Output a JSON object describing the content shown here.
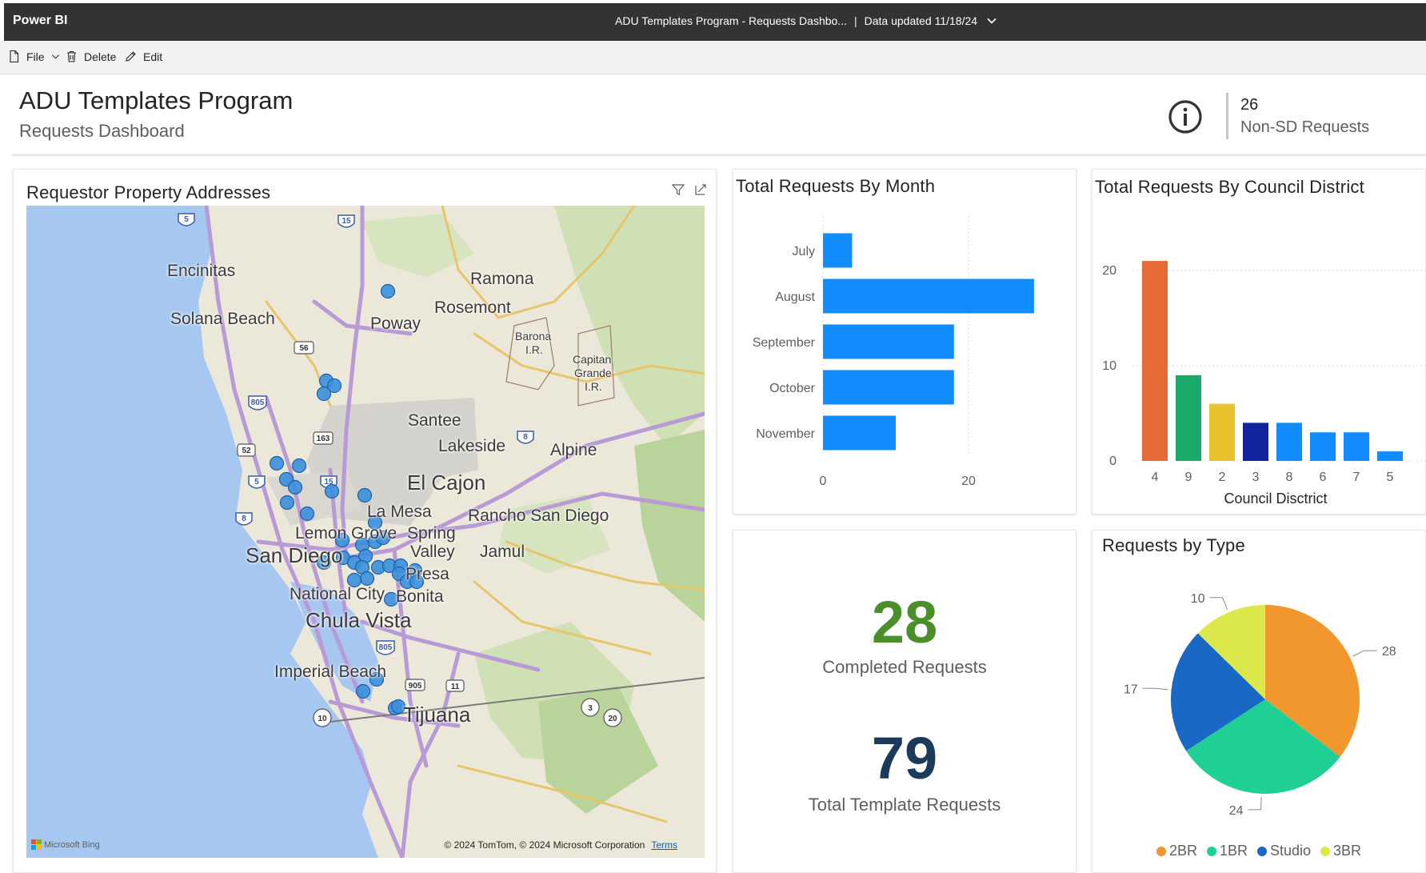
{
  "app": {
    "brand": "Power BI",
    "report_title": "ADU Templates Program - Requests Dashbo...",
    "data_updated": "Data updated 11/18/24"
  },
  "toolbar": {
    "file_label": "File",
    "delete_label": "Delete",
    "edit_label": "Edit"
  },
  "header": {
    "title": "ADU Templates Program",
    "subtitle": "Requests Dashboard",
    "non_sd_value": "26",
    "non_sd_label": "Non-SD Requests"
  },
  "map": {
    "title": "Requestor Property Addresses",
    "cities": [
      "Encinitas",
      "Solana Beach",
      "Ramona",
      "Rosemont",
      "Poway",
      "Santee",
      "Lakeside",
      "Alpine",
      "El Cajon",
      "La Mesa",
      "Rancho San Diego",
      "Lemon Grove",
      "Spring",
      "Valley",
      "Jamul",
      "San Diego",
      "Presa",
      "National City",
      "Bonita",
      "Chula Vista",
      "Imperial Beach",
      "Tijuana",
      "Barona",
      "I.R.",
      "Capitan",
      "Grande",
      "I.R."
    ],
    "highways": [
      "5",
      "15",
      "56",
      "805",
      "52",
      "163",
      "8",
      "15",
      "5",
      "8",
      "805",
      "905",
      "11",
      "10",
      "3",
      "20"
    ],
    "bing_label": "Microsoft Bing",
    "credits": "© 2024 TomTom, © 2024 Microsoft Corporation",
    "terms": "Terms",
    "point_color": "#3a8fdc"
  },
  "kpis": {
    "completed_value": "28",
    "completed_label": "Completed Requests",
    "completed_color": "#4a8f2a",
    "total_value": "79",
    "total_label": "Total Template Requests",
    "total_color": "#1b3a5c"
  },
  "chart_data": [
    {
      "type": "bar",
      "orientation": "horizontal",
      "title": "Total Requests By Month",
      "categories": [
        "July",
        "August",
        "September",
        "October",
        "November"
      ],
      "values": [
        4,
        29,
        18,
        18,
        10
      ],
      "xlim": [
        0,
        30
      ],
      "xticks": [
        "0",
        "20"
      ],
      "grid": true,
      "color": "#118dff"
    },
    {
      "type": "bar",
      "title": "Total Requests By Council District",
      "xlabel": "Council Disctrict",
      "categories": [
        "4",
        "9",
        "2",
        "3",
        "8",
        "6",
        "7",
        "5"
      ],
      "values": [
        21,
        9,
        6,
        4,
        4,
        3,
        3,
        1
      ],
      "colors": [
        "#e66c37",
        "#1aab6a",
        "#e8c12e",
        "#12239e",
        "#118dff",
        "#118dff",
        "#118dff",
        "#118dff"
      ],
      "ylim": [
        0,
        22
      ],
      "yticks": [
        "0",
        "10",
        "20"
      ],
      "grid": true
    },
    {
      "type": "pie",
      "title": "Requests by Type",
      "labels": [
        "2BR",
        "1BR",
        "Studio",
        "3BR"
      ],
      "values": [
        28,
        24,
        17,
        10
      ],
      "data_labels": [
        "28",
        "24",
        "17",
        "10"
      ],
      "colors": [
        "#f2962e",
        "#1fcf94",
        "#1868c4",
        "#dce84a"
      ],
      "legend": "bottom"
    }
  ]
}
